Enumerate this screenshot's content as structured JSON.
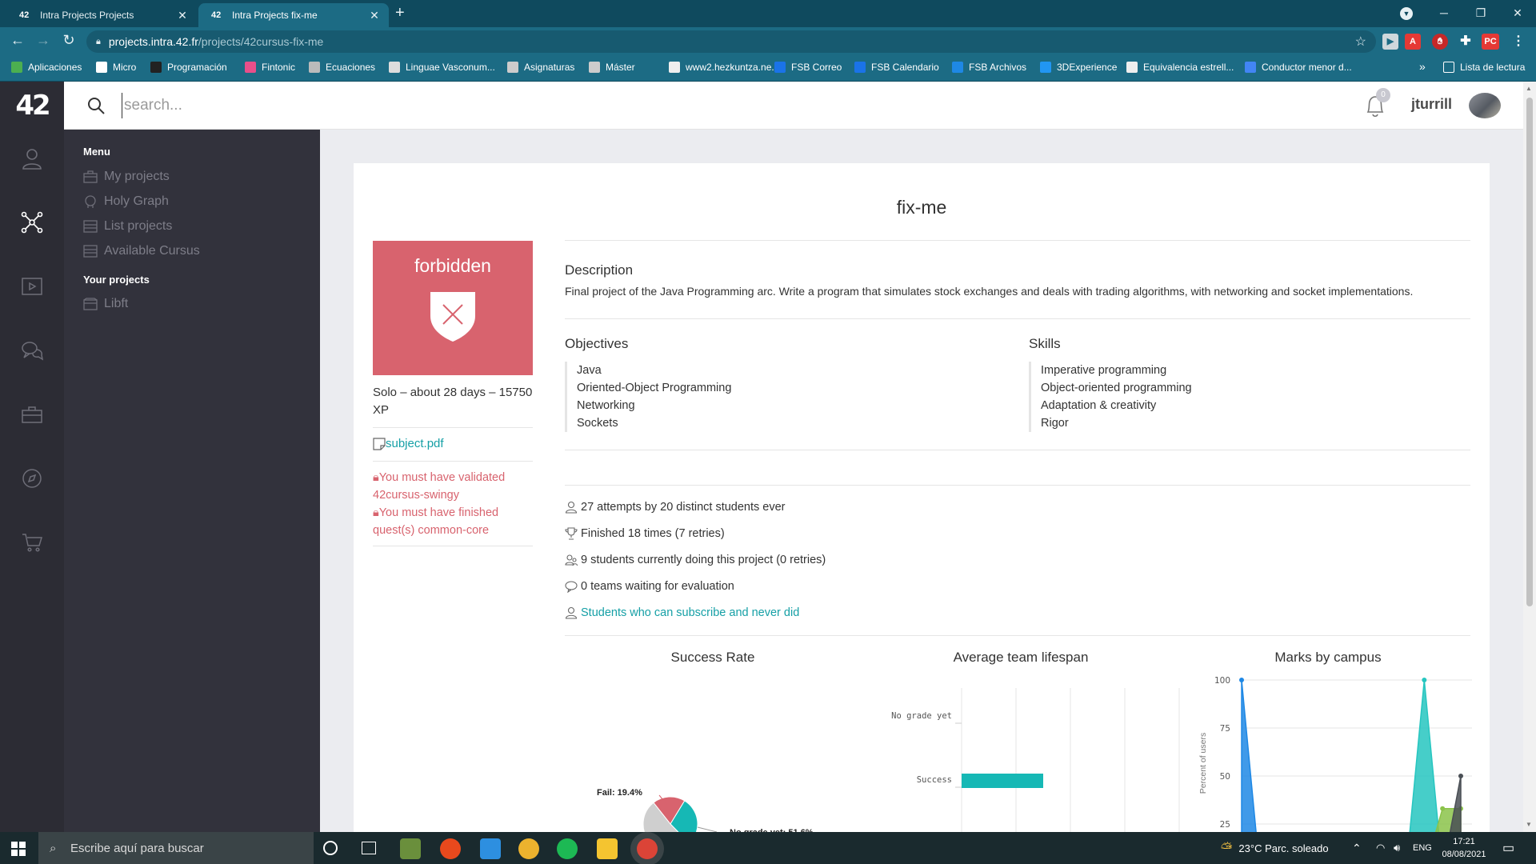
{
  "browser": {
    "tabs": [
      {
        "title": "Intra Projects Projects",
        "active": false
      },
      {
        "title": "Intra Projects fix-me",
        "active": true
      }
    ],
    "url_host": "projects.intra.42.fr",
    "url_path": "/projects/42cursus-fix-me",
    "bookmarks": [
      {
        "label": "Aplicaciones",
        "color": "#4caf50"
      },
      {
        "label": "Micro",
        "color": "#ffffff"
      },
      {
        "label": "Programación",
        "color": "#222222"
      },
      {
        "label": "Fintonic",
        "color": "#e84f8a"
      },
      {
        "label": "Ecuaciones",
        "color": "#bbbbbb"
      },
      {
        "label": "Linguae Vasconum...",
        "color": "#dddddd"
      },
      {
        "label": "Asignaturas",
        "color": "#cccccc"
      },
      {
        "label": "Máster",
        "color": "#cccccc"
      },
      {
        "label": "www2.hezkuntza.ne...",
        "color": "#eeeeee"
      },
      {
        "label": "FSB Correo",
        "color": "#1a73e8"
      },
      {
        "label": "FSB Calendario",
        "color": "#1a73e8"
      },
      {
        "label": "FSB Archivos",
        "color": "#1e88e5"
      },
      {
        "label": "3DExperience",
        "color": "#2196f3"
      },
      {
        "label": "Equivalencia estrell...",
        "color": "#eeeeee"
      },
      {
        "label": "Conductor menor d...",
        "color": "#4285f4"
      }
    ],
    "bookmarks_overflow": "»",
    "reading_list": "Lista de lectura",
    "ext_pc": "PC"
  },
  "site": {
    "logo": "42",
    "search_placeholder": "search...",
    "notifications_count": "0",
    "username": "jturrill"
  },
  "sidemenu": {
    "menu_heading": "Menu",
    "menu_items": [
      "My projects",
      "Holy Graph",
      "List projects",
      "Available Cursus"
    ],
    "your_projects_heading": "Your projects",
    "your_projects": [
      "Libft"
    ]
  },
  "project": {
    "title": "fix-me",
    "status_label": "forbidden",
    "meta": "Solo – about 28 days – 15750 XP",
    "attachment": "subject.pdf",
    "requirements": [
      "You must have validated 42cursus-swingy",
      "You must have finished quest(s) common-core"
    ],
    "description_heading": "Description",
    "description": "Final project of the Java Programming arc. Write a program that simulates stock exchanges and deals with trading algorithms, with networking and socket implementations.",
    "objectives_heading": "Objectives",
    "objectives": [
      "Java",
      "Oriented-Object Programming",
      "Networking",
      "Sockets"
    ],
    "skills_heading": "Skills",
    "skills": [
      "Imperative programming",
      "Object-oriented programming",
      "Adaptation & creativity",
      "Rigor"
    ],
    "stats": [
      {
        "icon": "user-icon",
        "text": "27 attempts by 20 distinct students ever",
        "link": false
      },
      {
        "icon": "trophy-icon",
        "text": "Finished 18 times (7 retries)",
        "link": false
      },
      {
        "icon": "users-icon",
        "text": "9 students currently doing this project (0 retries)",
        "link": false
      },
      {
        "icon": "chat-icon",
        "text": "0 teams waiting for evaluation",
        "link": false
      },
      {
        "icon": "user-icon",
        "text": "Students who can subscribe and never did",
        "link": true
      }
    ]
  },
  "chart_data": [
    {
      "type": "pie",
      "title": "Success Rate",
      "slices": [
        {
          "label": "Fail",
          "value": 19.4,
          "color": "#d8636e"
        },
        {
          "label": "Success",
          "value": 29.0,
          "color": "#16b8b5"
        },
        {
          "label": "No grade yet",
          "value": 51.6,
          "color": "#cfcfcf"
        }
      ],
      "data_labels": [
        "Fail: 19.4%",
        "No grade yet: 51.6%"
      ]
    },
    {
      "type": "bar",
      "orientation": "horizontal",
      "title": "Average team lifespan",
      "categories": [
        "No grade yet",
        "Success"
      ],
      "values": [
        0,
        15
      ],
      "xlim": [
        0,
        40
      ],
      "color": "#16b8b5"
    },
    {
      "type": "area",
      "title": "Marks by campus",
      "ylabel": "Percent of users",
      "ylim": [
        0,
        100
      ],
      "yticks": [
        100,
        75,
        50,
        25
      ],
      "x": [
        0,
        10,
        20,
        30,
        40,
        50,
        60,
        70,
        80,
        90,
        100,
        110,
        120
      ],
      "series": [
        {
          "values": [
            100,
            0,
            0,
            0,
            0,
            0,
            0,
            0,
            0,
            0,
            0,
            0,
            0
          ],
          "color": "#1e88e5"
        },
        {
          "values": [
            0,
            0,
            0,
            0,
            0,
            0,
            0,
            0,
            0,
            0,
            100,
            0,
            0
          ],
          "color": "#26c6c0"
        },
        {
          "values": [
            0,
            0,
            0,
            0,
            0,
            0,
            0,
            0,
            0,
            0,
            0,
            33,
            33
          ],
          "color": "#8bc34a"
        },
        {
          "values": [
            0,
            0,
            0,
            0,
            0,
            0,
            0,
            0,
            0,
            0,
            0,
            0,
            50
          ],
          "color": "#4a4f55"
        }
      ]
    }
  ],
  "taskbar": {
    "search_placeholder": "Escribe aquí para buscar",
    "weather": "23°C  Parc. soleado",
    "language": "ENG",
    "time": "17:21",
    "date": "08/08/2021"
  }
}
